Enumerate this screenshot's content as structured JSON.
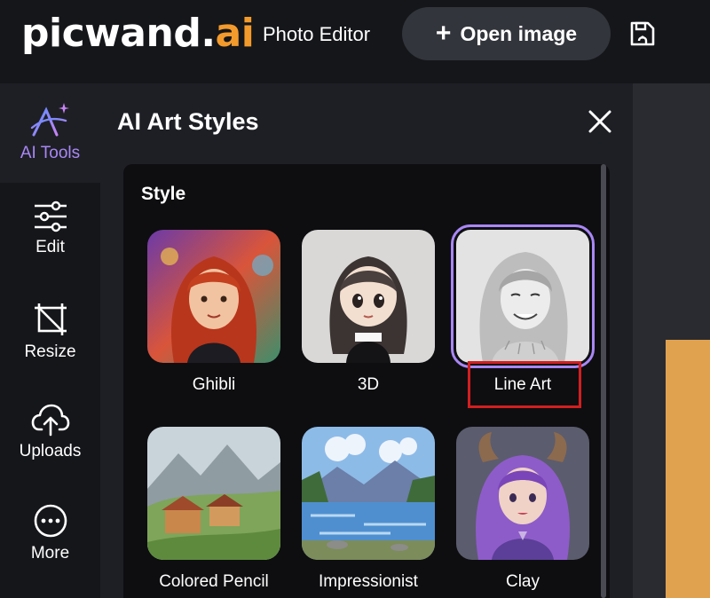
{
  "header": {
    "logo_main": "picwand.",
    "logo_accent": "ai",
    "subtitle": "Photo Editor",
    "open_button_label": "Open image",
    "open_button_icon": "plus-icon",
    "save_icon": "save-icon"
  },
  "sidebar": {
    "items": [
      {
        "label": "AI Tools",
        "icon": "ai-sparkle-icon",
        "active": true
      },
      {
        "label": "Edit",
        "icon": "sliders-icon",
        "active": false
      },
      {
        "label": "Resize",
        "icon": "crop-resize-icon",
        "active": false
      },
      {
        "label": "Uploads",
        "icon": "cloud-upload-icon",
        "active": false
      },
      {
        "label": "More",
        "icon": "more-icon",
        "active": false
      }
    ]
  },
  "panel": {
    "title": "AI Art Styles",
    "close_icon": "close-icon",
    "section_label": "Style",
    "styles": [
      {
        "label": "Ghibli",
        "selected": false
      },
      {
        "label": "3D",
        "selected": false
      },
      {
        "label": "Line Art",
        "selected": true
      },
      {
        "label": "Colored Pencil",
        "selected": false
      },
      {
        "label": "Impressionist",
        "selected": false
      },
      {
        "label": "Clay",
        "selected": false
      }
    ]
  },
  "colors": {
    "accent_purple": "#a987f5",
    "logo_orange": "#f39a2c",
    "highlight_red": "#d21f1f",
    "canvas_image": "#e0a24f"
  }
}
